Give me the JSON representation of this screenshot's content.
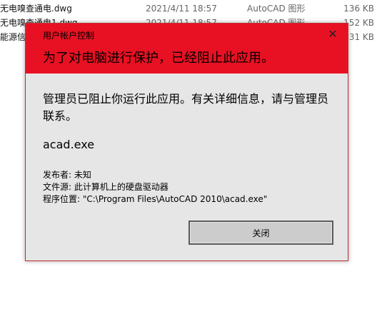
{
  "file_list": [
    {
      "name": "无电嗅查通电.dwg",
      "date": "2021/4/11 18:57",
      "type": "AutoCAD 图形",
      "size": "136 KB"
    },
    {
      "name": "无电嗅查通电1.dwg",
      "date": "2021/4/11 18:57",
      "type": "AutoCAD 图形",
      "size": "152 KB"
    },
    {
      "name": "能源信",
      "date": "",
      "type": "",
      "size": "31 KB"
    }
  ],
  "dialog": {
    "title": "用户帐户控制",
    "close_glyph": "✕",
    "headline": "为了对电脑进行保护，已经阻止此应用。",
    "message": "管理员已阻止你运行此应用。有关详细信息，请与管理员联系。",
    "app_name": "acad.exe",
    "publisher": "发布者: 未知",
    "file_source": "文件源: 此计算机上的硬盘驱动器",
    "program_location": "程序位置: \"C:\\Program Files\\AutoCAD 2010\\acad.exe\"",
    "close_button_label": "关闭"
  },
  "colors": {
    "header": "#e81123",
    "dialog_bg": "#e6e6e6",
    "button_bg": "#cccccc"
  }
}
